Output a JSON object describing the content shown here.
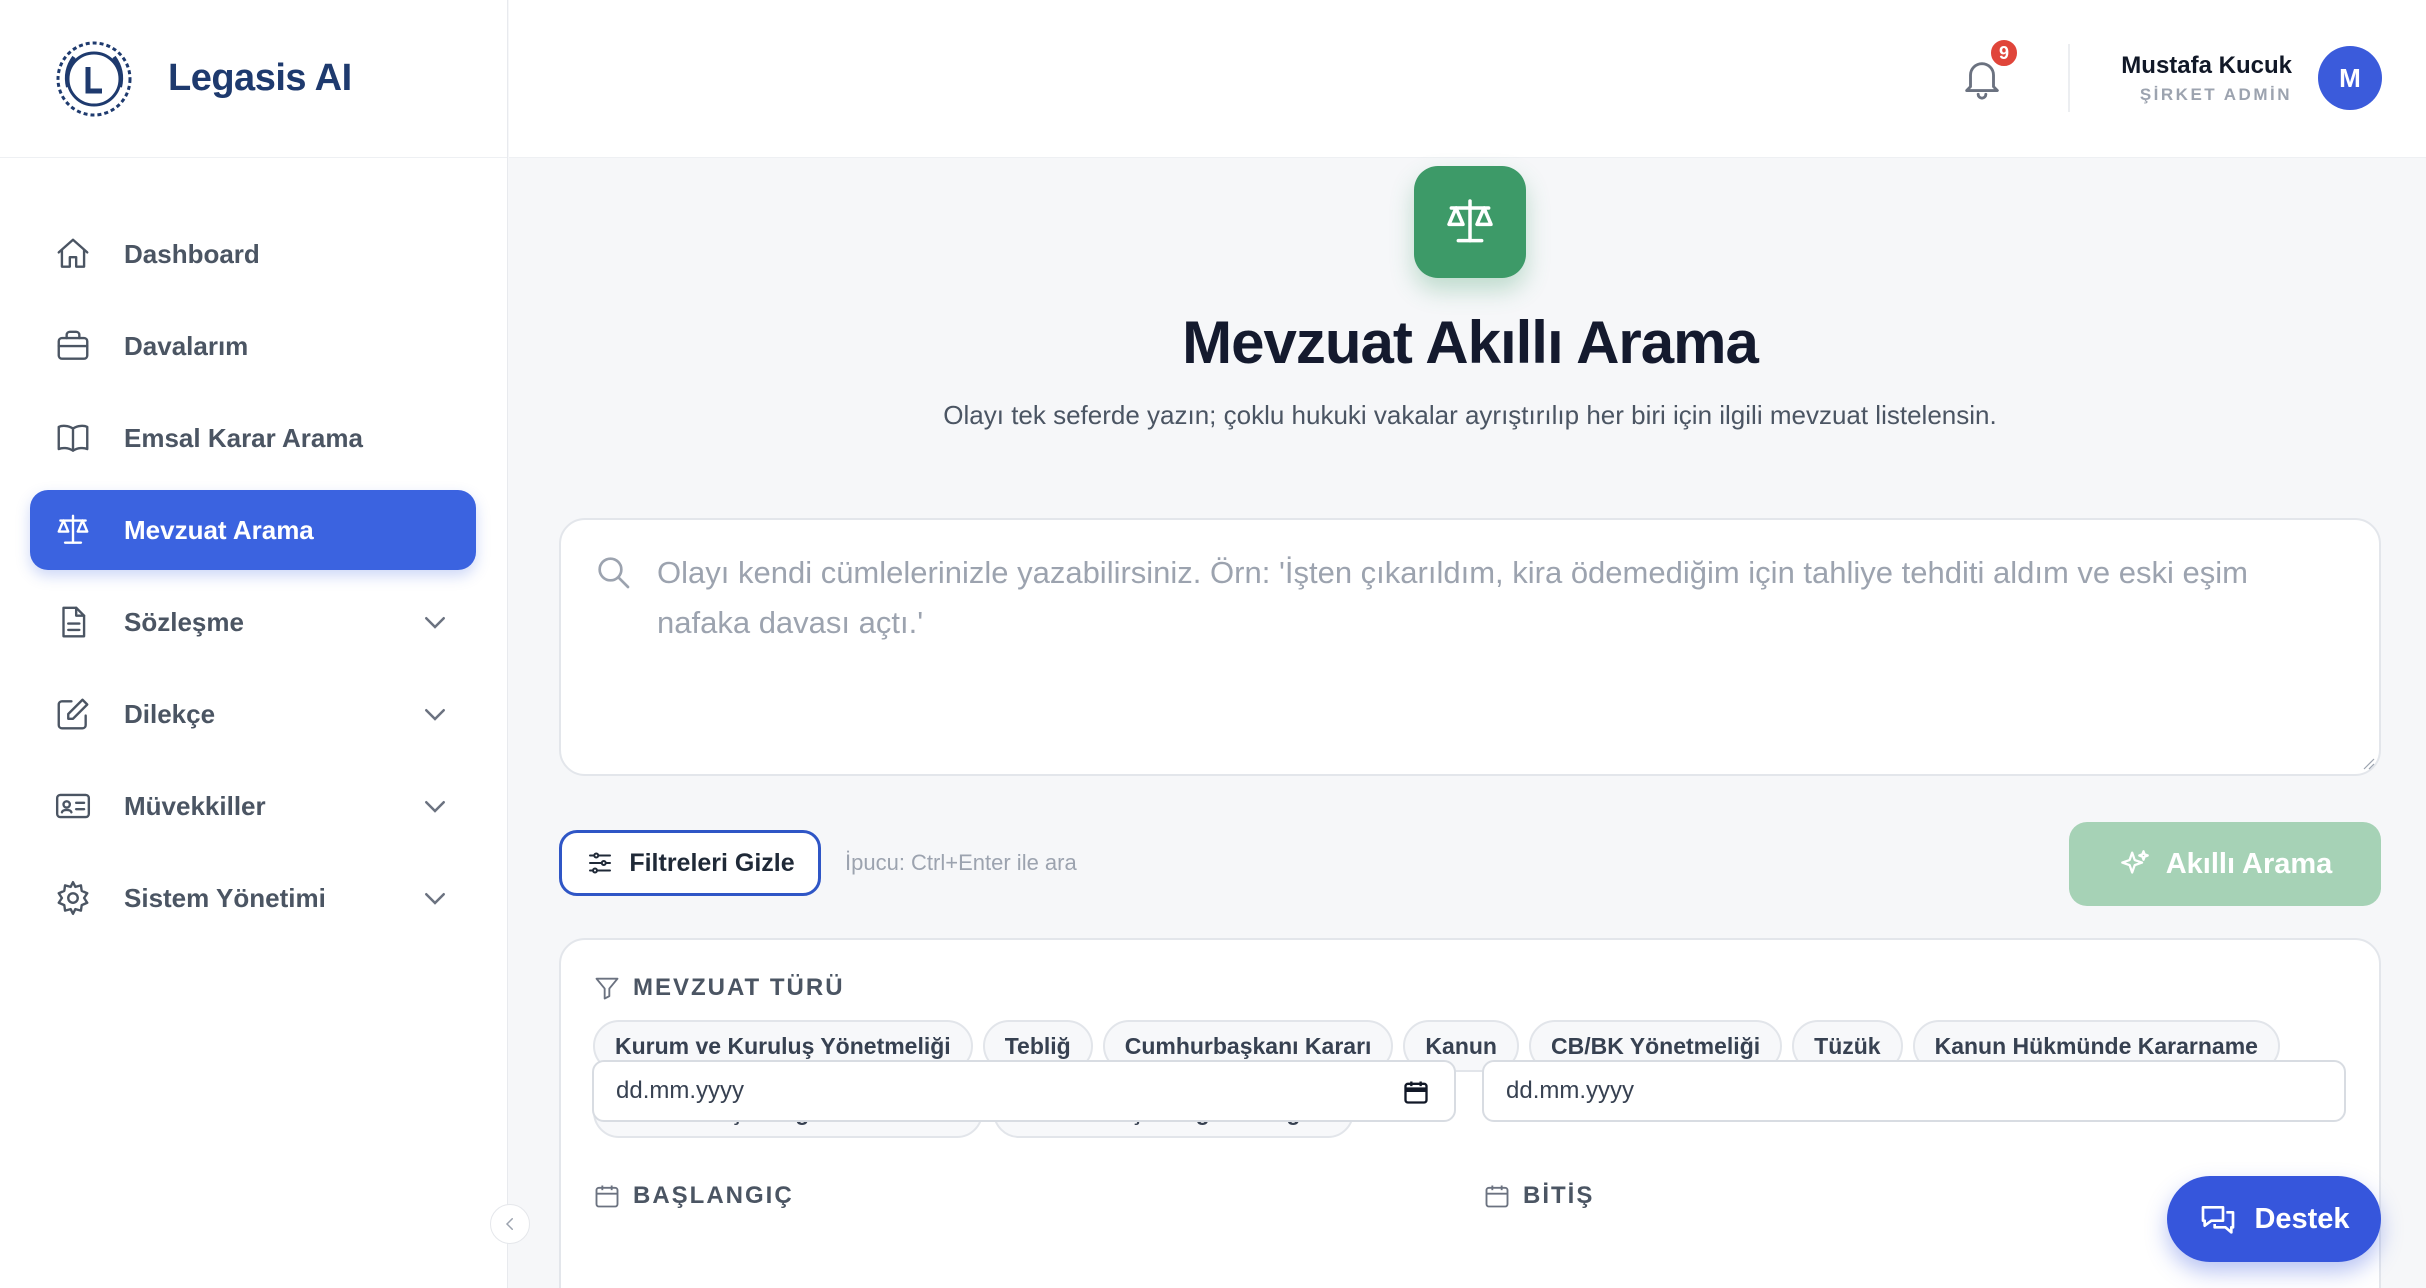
{
  "brand": {
    "name": "Legasis AI"
  },
  "sidebar": {
    "items": [
      {
        "label": "Dashboard",
        "icon": "home-icon",
        "active": false,
        "expandable": false
      },
      {
        "label": "Davalarım",
        "icon": "briefcase-icon",
        "active": false,
        "expandable": false
      },
      {
        "label": "Emsal Karar Arama",
        "icon": "book-icon",
        "active": false,
        "expandable": false
      },
      {
        "label": "Mevzuat Arama",
        "icon": "scale-icon",
        "active": true,
        "expandable": false
      },
      {
        "label": "Sözleşme",
        "icon": "document-icon",
        "active": false,
        "expandable": true
      },
      {
        "label": "Dilekçe",
        "icon": "pencil-square-icon",
        "active": false,
        "expandable": true
      },
      {
        "label": "Müvekkiller",
        "icon": "id-card-icon",
        "active": false,
        "expandable": true
      },
      {
        "label": "Sistem Yönetimi",
        "icon": "gear-icon",
        "active": false,
        "expandable": true
      }
    ]
  },
  "header": {
    "notifications_count": "9",
    "user_name": "Mustafa Kucuk",
    "user_role": "ŞİRKET ADMİN",
    "avatar_initial": "M"
  },
  "main": {
    "title": "Mevzuat Akıllı Arama",
    "subtitle": "Olayı tek seferde yazın; çoklu hukuki vakalar ayrıştırılıp her biri için ilgili mevzuat listelensin.",
    "search_placeholder": "Olayı kendi cümlelerinizle yazabilirsiniz. Örn: 'İşten çıkarıldım, kira ödemediğim için tahliye tehditi aldım ve eski eşim nafaka davası açtı.'",
    "search_value": "",
    "filter_button_label": "Filtreleri Gizle",
    "hint": "İpucu: Ctrl+Enter ile ara",
    "smart_search_label": "Akıllı Arama",
    "filters": {
      "type_label": "MEVZUAT TÜRÜ",
      "types": [
        "Kurum ve Kuruluş Yönetmeliği",
        "Tebliğ",
        "Cumhurbaşkanı Kararı",
        "Kanun",
        "CB/BK Yönetmeliği",
        "Tüzük",
        "Kanun Hükmünde Kararname",
        "Cumhurbaşkanlığı Kararnamesi",
        "Cumhurbaşkanlığı Genelgesi"
      ],
      "start_label": "BAŞLANGIÇ",
      "end_label": "BİTİŞ",
      "start_value": "dd.mm.yyyy",
      "end_value": "dd.mm.yyyy"
    }
  },
  "support": {
    "label": "Destek"
  },
  "colors": {
    "primary": "#3b63e0",
    "brand_text": "#1e3a6e",
    "hero_green": "#3d9a68",
    "smart_button": "#a6d2b6",
    "badge": "#e0453a"
  }
}
